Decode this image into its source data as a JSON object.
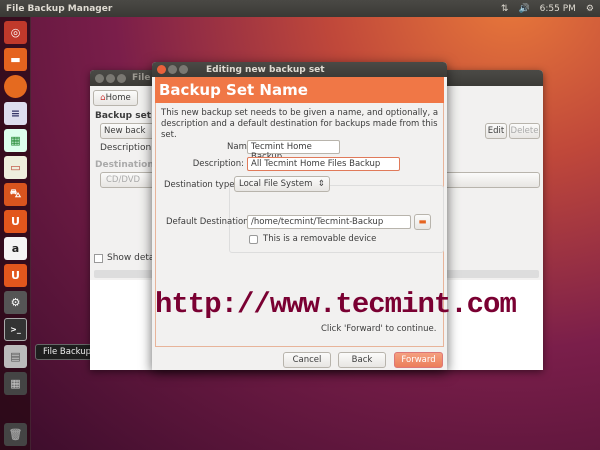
{
  "panel": {
    "app_title": "File Backup Manager",
    "network": "⇅",
    "volume": "🔊",
    "time": "6:55 PM",
    "gear": "⚙"
  },
  "launcher": {
    "tooltip": "File Backup Manager",
    "items": [
      "Dash",
      "Files",
      "Firefox",
      "Writer",
      "Calc",
      "Impress",
      "Software Center",
      "Ubuntu One",
      "Amazon",
      "Ubuntu One Music",
      "System Settings",
      "Terminal",
      "File Backup Manager",
      "Workspaces",
      "Trash"
    ]
  },
  "bg_window": {
    "title": "File",
    "home": "Home",
    "backup_set_label": "Backup set",
    "new_backup": "New back",
    "edit": "Edit",
    "delete": "Delete",
    "description_label": "Description:",
    "destination_label": "Destination",
    "destination_value": "CD/DVD",
    "show_details": "Show detail"
  },
  "dialog": {
    "title": "Editing new backup set",
    "header": "Backup Set Name",
    "intro": "This new backup set needs to be given a name, and optionally, a description and a default destination for backups made from this set.",
    "name_label": "Name:",
    "name_value": "Tecmint Home Backup",
    "description_label": "Description:",
    "description_value": "All Tecmint Home Files Backup",
    "dest_type_label": "Destination type:",
    "dest_type_value": "Local File System",
    "default_dest_label": "Default Destination:",
    "default_dest_value": "/home/tecmint/Tecmint-Backup",
    "removable_label": "This is a removable device",
    "removable_checked": false,
    "hint": "Click 'Forward' to continue.",
    "cancel": "Cancel",
    "back": "Back",
    "forward": "Forward"
  },
  "watermark": "http://www.tecmint.com"
}
